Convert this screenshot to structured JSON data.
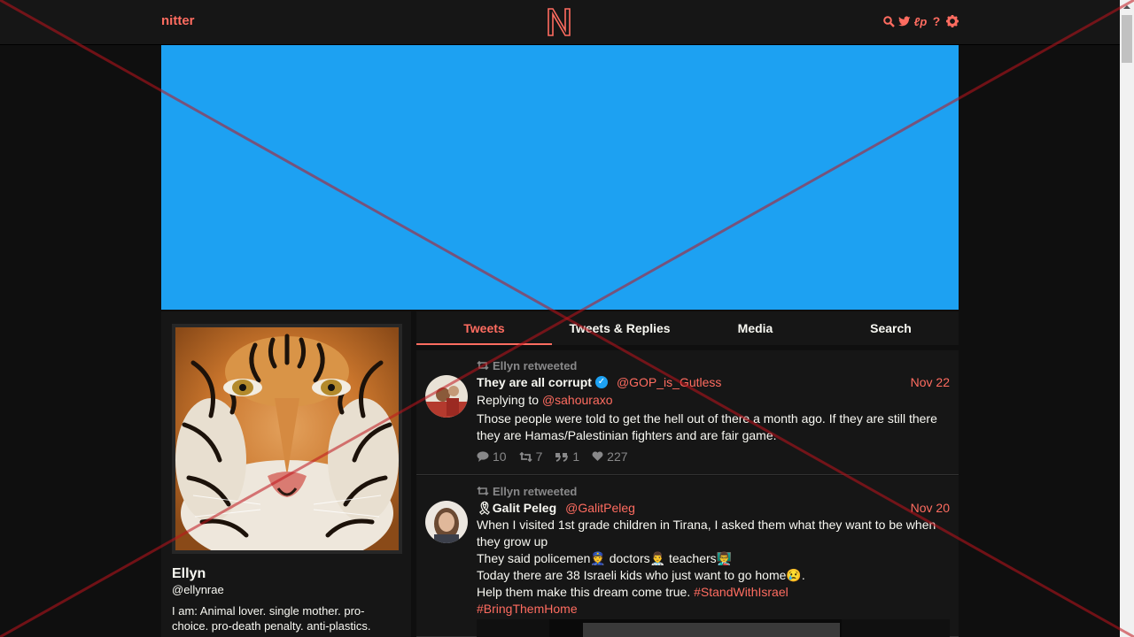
{
  "navbar": {
    "brand": "nitter",
    "logo_letter": "N",
    "icons": [
      "search-icon",
      "twitter-icon",
      "lp-icon",
      "help-icon",
      "gear-icon"
    ]
  },
  "colors": {
    "accent": "#ff6c60",
    "banner": "#1da1f2",
    "background": "#0f0f0f",
    "panel": "#161616",
    "muted": "#888889"
  },
  "profile": {
    "name": "Ellyn",
    "handle": "@ellynrae",
    "bio": "I am: Animal lover. single mother. pro-choice. pro-death penalty. anti-plastics."
  },
  "tabs": [
    "Tweets",
    "Tweets & Replies",
    "Media",
    "Search"
  ],
  "active_tab": "Tweets",
  "tweets": [
    {
      "retweet_header": "Ellyn retweeted",
      "name": "They are all corrupt",
      "verified": true,
      "username": "@GOP_is_Gutless",
      "date": "Nov 22",
      "replying_label": "Replying to",
      "replying_to": "@sahouraxo",
      "text": "Those people were told to get the hell out of there a month ago. If they are still there they are Hamas/Palestinian fighters and are fair game.",
      "stats": {
        "replies": "10",
        "retweets": "7",
        "quotes": "1",
        "likes": "227"
      }
    },
    {
      "retweet_header": "Ellyn retweeted",
      "name": "🎗Galit Peleg",
      "verified": false,
      "username": "@GalitPeleg",
      "date": "Nov 20",
      "lines": [
        "When I visited 1st grade children in Tirana, I asked them what they want to be when they grow up",
        " They said policemen👮 doctors👨‍⚕️ teachers👨‍🏫",
        " Today there are 38 Israeli kids who just want to go home😢.",
        "Help them make this dream come true. "
      ],
      "hashtags": [
        "#StandWithIsrael",
        "#BringThemHome"
      ]
    }
  ]
}
